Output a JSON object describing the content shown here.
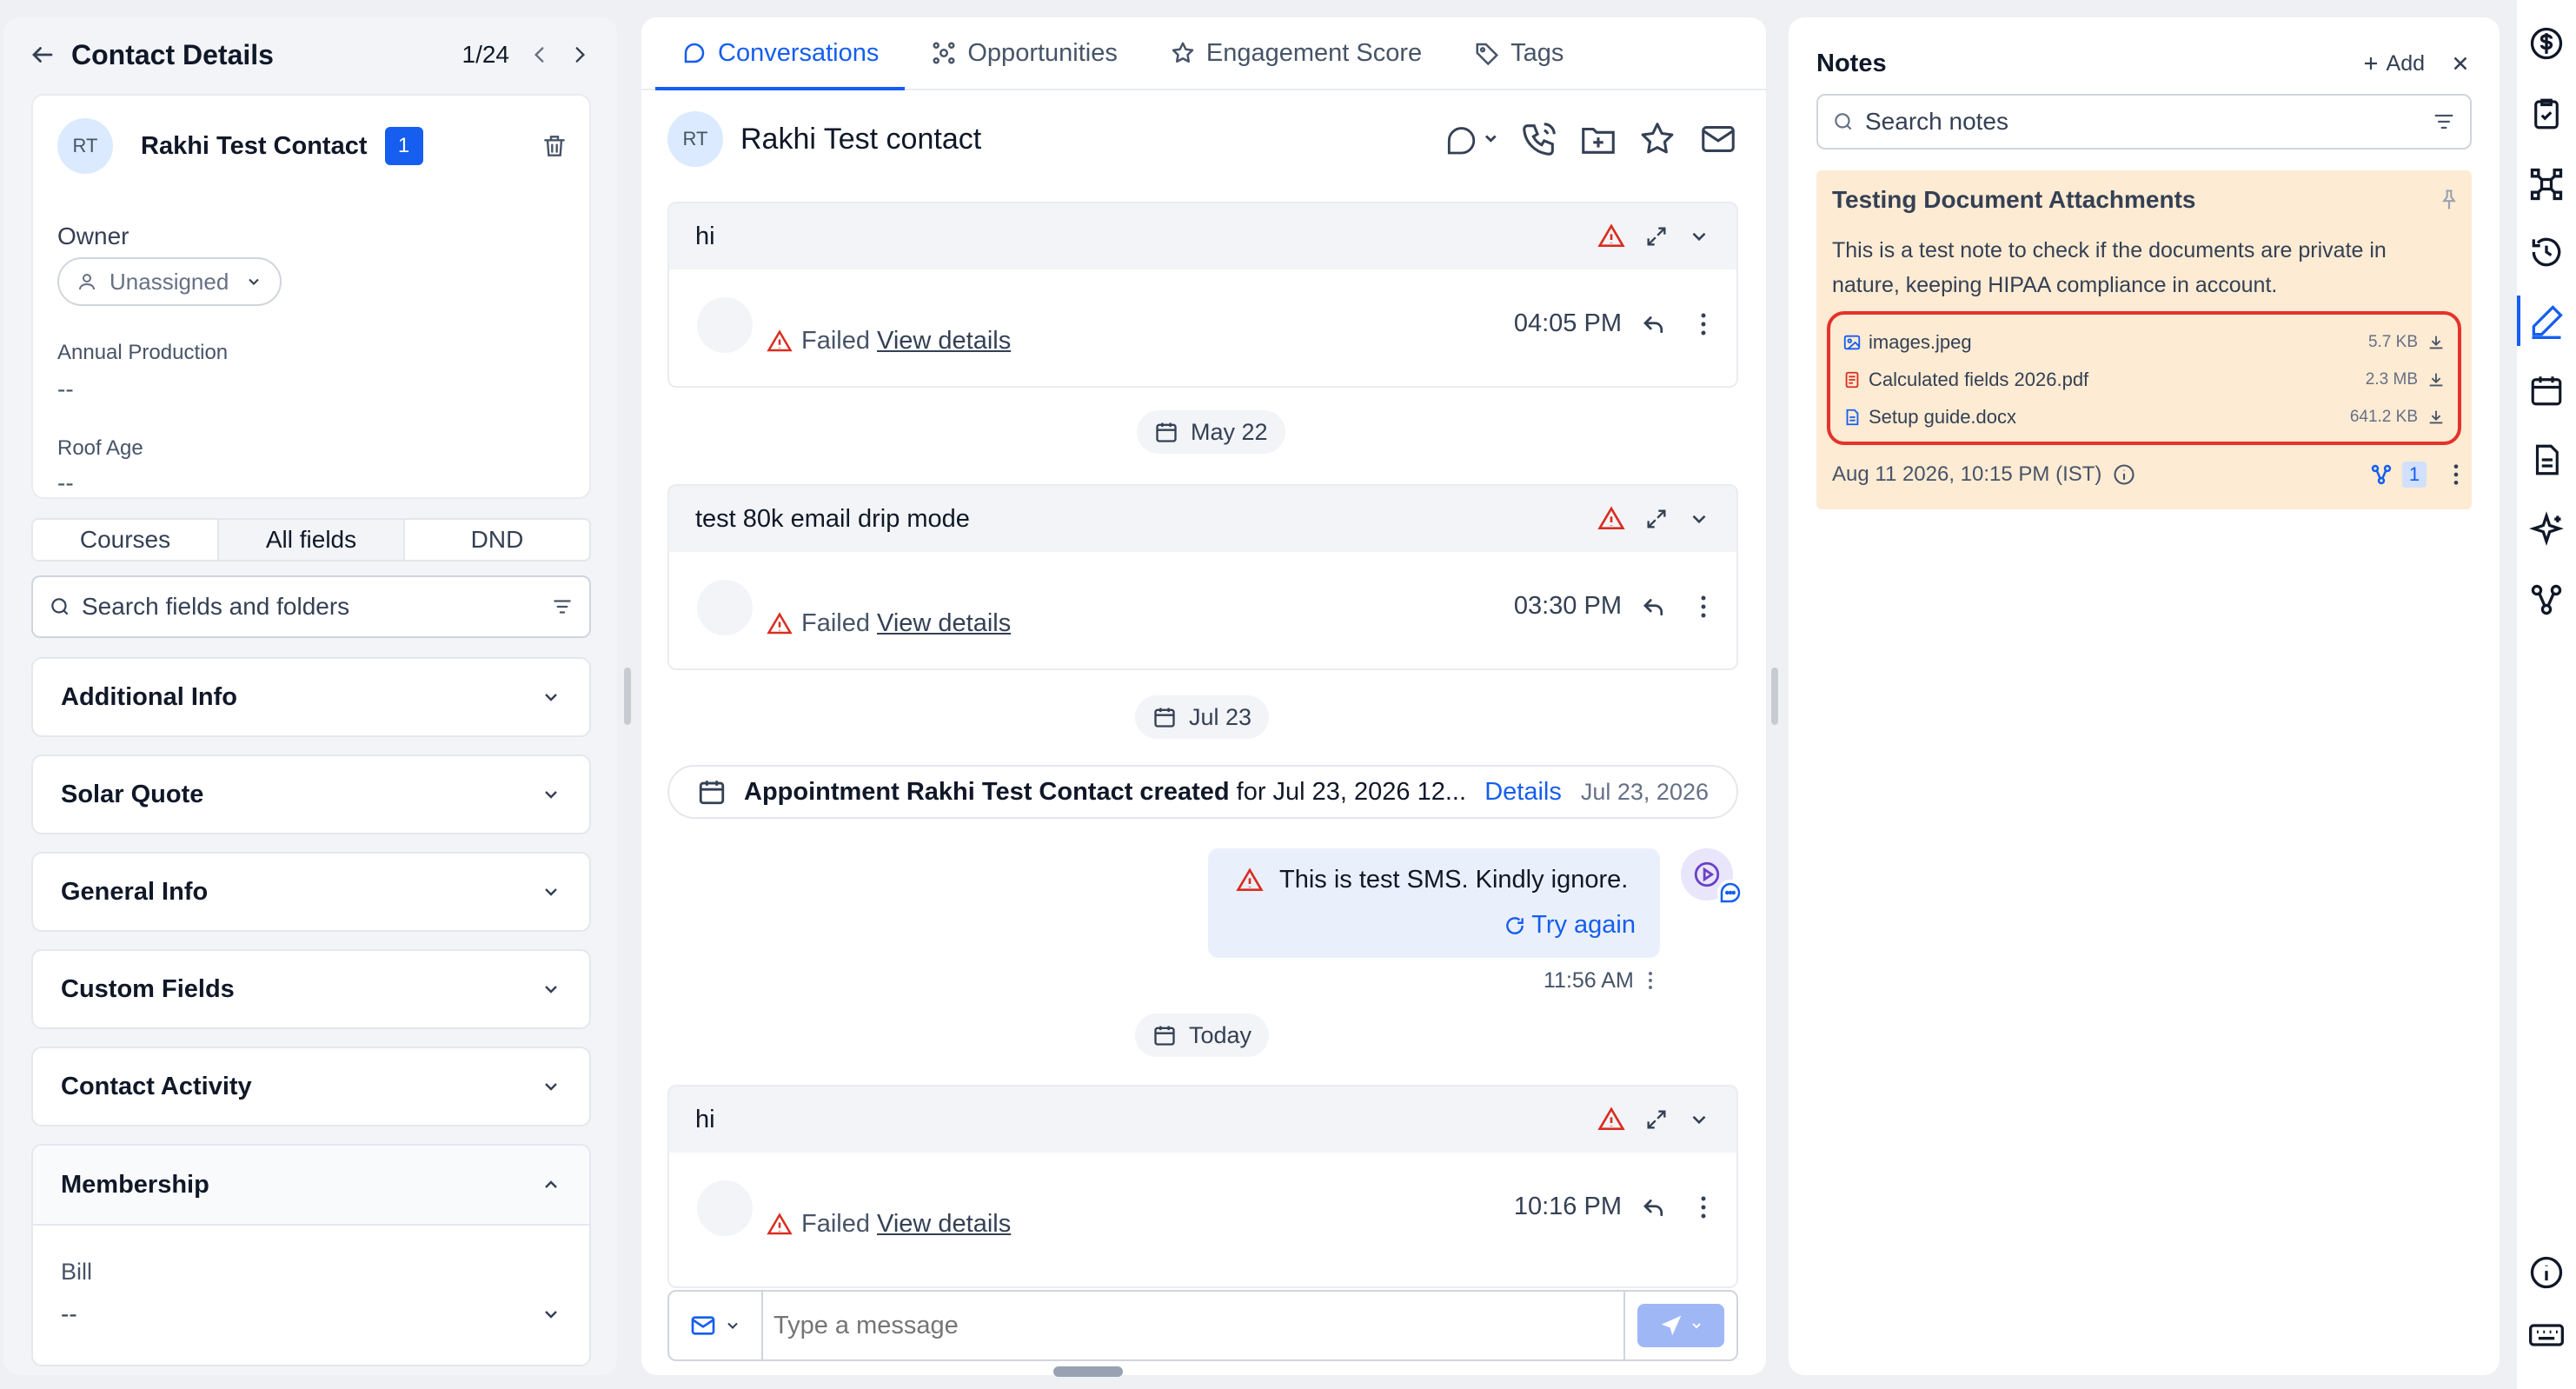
{
  "contact_panel": {
    "title": "Contact Details",
    "pager": "1/24",
    "contact_name": "Rakhi Test Contact",
    "avatar_initials": "RT",
    "badge_count": "1",
    "owner_label": "Owner",
    "owner_value": "Unassigned",
    "fields": [
      {
        "label": "Annual Production",
        "value": "--"
      },
      {
        "label": "Roof Age",
        "value": "--"
      }
    ],
    "segments": [
      "Courses",
      "All fields",
      "DND"
    ],
    "search_placeholder": "Search fields and folders",
    "sections": [
      "Additional Info",
      "Solar Quote",
      "General Info",
      "Custom Fields",
      "Contact Activity",
      "Membership"
    ],
    "membership_field": {
      "label": "Bill",
      "value": "--"
    }
  },
  "conversation": {
    "tabs": [
      "Conversations",
      "Opportunities",
      "Engagement Score",
      "Tags"
    ],
    "contact_name": "Rakhi Test contact",
    "avatar_initials": "RT",
    "messages": [
      {
        "title": "hi",
        "status": "Failed",
        "link": "View details",
        "time": "04:05 PM"
      },
      {
        "title": "test 80k email drip mode",
        "status": "Failed",
        "link": "View details",
        "time": "03:30 PM"
      },
      {
        "title": "hi",
        "status": "Failed",
        "link": "View details",
        "time": "10:16 PM"
      }
    ],
    "dates": [
      "May 22",
      "Jul 23",
      "Today"
    ],
    "appointment": {
      "bold": "Appointment Rakhi Test Contact created",
      "rest": " for Jul 23, 2026 12...",
      "link": "Details",
      "date": "Jul 23, 2026"
    },
    "sms": {
      "text": "This is test SMS. Kindly ignore.",
      "retry": "Try again",
      "time": "11:56 AM"
    },
    "composer_placeholder": "Type a message"
  },
  "notes": {
    "title": "Notes",
    "add_label": "Add",
    "search_placeholder": "Search notes",
    "note": {
      "title": "Testing Document Attachments",
      "body": "This is a test note to check if the documents are private in nature, keeping HIPAA compliance in account.",
      "attachments": [
        {
          "name": "images.jpeg",
          "size": "5.7 KB"
        },
        {
          "name": "Calculated fields 2026.pdf",
          "size": "2.3 MB"
        },
        {
          "name": "Setup guide.docx",
          "size": "641.2 KB"
        }
      ],
      "timestamp": "Aug 11 2026, 10:15 PM (IST)",
      "workflow_count": "1"
    }
  },
  "colors": {
    "accent": "#155eef",
    "error": "#d92d20",
    "note_bg": "#fdebd3",
    "highlight": "#e5322d"
  }
}
